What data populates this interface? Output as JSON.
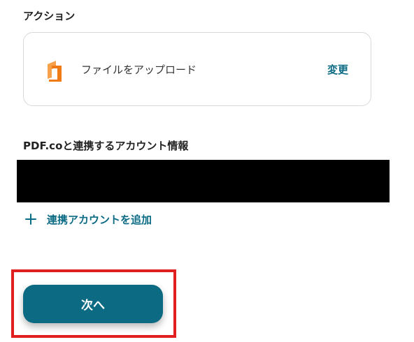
{
  "action_section": {
    "title": "アクション",
    "card": {
      "icon": "pdfco-logo-icon",
      "label": "ファイルをアップロード",
      "change_label": "変更"
    }
  },
  "account_section": {
    "title": "PDF.coと連携するアカウント情報",
    "account_value_redacted": true,
    "add_account_label": "連携アカウントを追加"
  },
  "footer": {
    "next_label": "次へ"
  },
  "colors": {
    "accent": "#0b6a84",
    "button": "#0c6a82",
    "highlight": "#e02020",
    "logo_orange": "#f28a1e"
  }
}
